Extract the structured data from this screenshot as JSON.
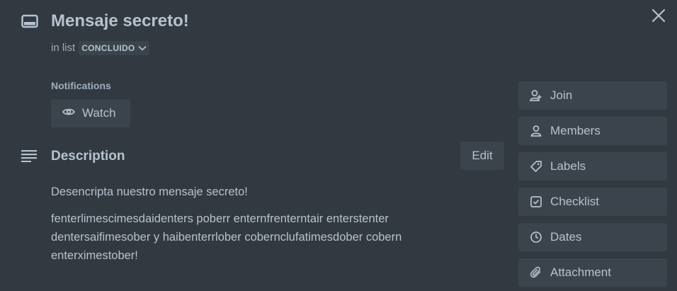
{
  "card": {
    "title": "Mensaje secreto!",
    "in_list_prefix": "in list",
    "list_name": "CONCLUIDO"
  },
  "notifications": {
    "heading": "Notifications",
    "watch_label": "Watch"
  },
  "description": {
    "heading": "Description",
    "edit_label": "Edit",
    "paragraphs": [
      "Desencripta nuestro mensaje secreto!",
      "fenterlimescimesdaidenters poberr enternfrenterntair enterstenter dentersaifimesober y haibenterrlober cobernclufatimesdober cobern enterximestober!"
    ]
  },
  "sidebar": {
    "items": [
      {
        "label": "Join",
        "icon": "add-member-icon"
      },
      {
        "label": "Members",
        "icon": "person-icon"
      },
      {
        "label": "Labels",
        "icon": "tag-icon"
      },
      {
        "label": "Checklist",
        "icon": "checkbox-icon"
      },
      {
        "label": "Dates",
        "icon": "clock-icon"
      },
      {
        "label": "Attachment",
        "icon": "paperclip-icon"
      }
    ]
  },
  "colors": {
    "background": "#323940",
    "button": "#3b444c",
    "text": "#b6c2cf",
    "muted": "#9fadbc"
  }
}
